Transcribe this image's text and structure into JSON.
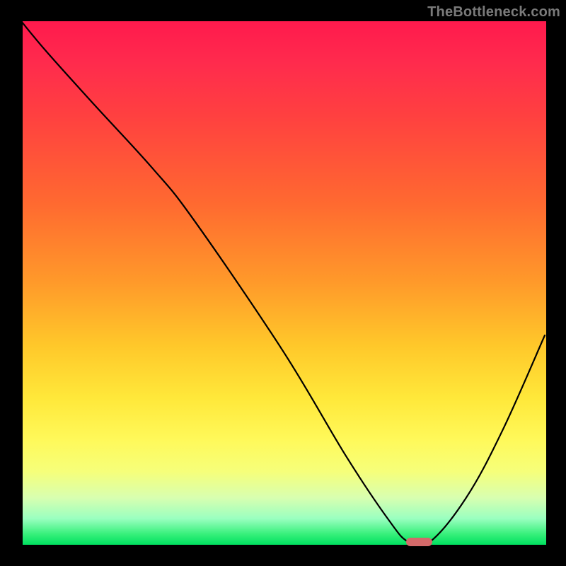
{
  "watermark": "TheBottleneck.com",
  "chart_data": {
    "type": "line",
    "title": "",
    "xlabel": "",
    "ylabel": "",
    "xlim": [
      0,
      100
    ],
    "ylim": [
      0,
      100
    ],
    "grid": false,
    "series": [
      {
        "name": "curve",
        "x": [
          0,
          5,
          14,
          25,
          33,
          50,
          62,
          70,
          74,
          78,
          85,
          92,
          100
        ],
        "y": [
          100,
          94,
          84,
          72,
          62,
          37,
          17,
          5,
          0.5,
          0.5,
          9,
          22,
          40
        ]
      }
    ],
    "annotations": [
      {
        "name": "minimum-marker",
        "x_center": 76,
        "width_pct": 5,
        "y": 0.5,
        "color": "#d46a6a"
      }
    ],
    "background_gradient": {
      "top_color": "#ff1a4d",
      "bottom_color": "#00e060",
      "description": "vertical red→orange→yellow→green"
    }
  }
}
